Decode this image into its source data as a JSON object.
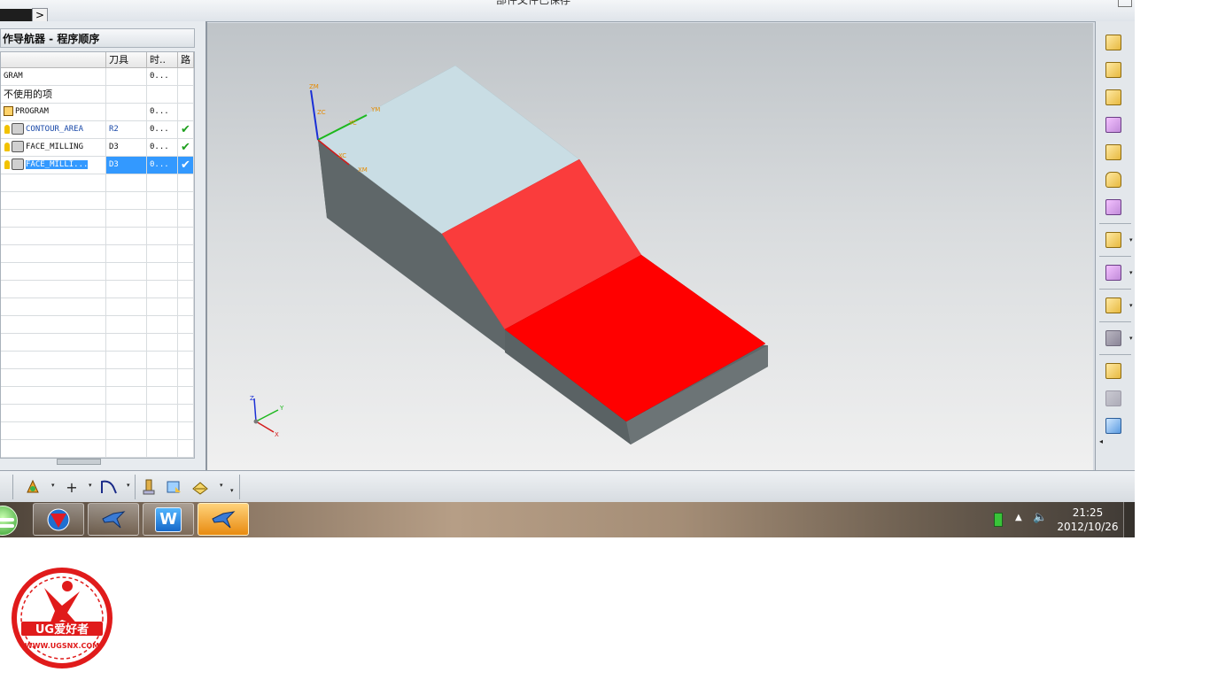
{
  "window": {
    "title": "部件文件已保存",
    "expand_arrow": ">"
  },
  "navigator": {
    "title": "作导航器 - 程序顺序",
    "columns": [
      "",
      "刀具",
      "时..",
      "路"
    ],
    "rows": [
      {
        "name": "GRAM",
        "tool": "",
        "time": "0...",
        "path": "",
        "indent": 0,
        "icon": "none",
        "style": "plain"
      },
      {
        "name": "不使用的项",
        "tool": "",
        "time": "",
        "path": "",
        "indent": 0,
        "icon": "none",
        "style": "plain"
      },
      {
        "name": "PROGRAM",
        "tool": "",
        "time": "0...",
        "path": "",
        "indent": 0,
        "icon": "program-icon",
        "style": "plain"
      },
      {
        "name": "CONTOUR_AREA",
        "tool": "R2",
        "time": "0...",
        "path": "✔",
        "indent": 1,
        "icon": "contour-operation-icon",
        "style": "blue"
      },
      {
        "name": "FACE_MILLING",
        "tool": "D3",
        "time": "0...",
        "path": "✔",
        "indent": 1,
        "icon": "face-milling-operation-icon",
        "style": "plain"
      },
      {
        "name": "FACE_MILLI...",
        "tool": "D3",
        "time": "0...",
        "path": "✔",
        "indent": 1,
        "icon": "face-milling-operation-icon",
        "style": "selected"
      }
    ],
    "empty_rows": 17
  },
  "viewport": {
    "wcs_labels": {
      "zm": "ZM",
      "zc": "ZC",
      "yc": "YC",
      "ym": "YM",
      "xc": "XC",
      "xm": "XM"
    },
    "triad_labels": {
      "z": "Z",
      "y": "Y",
      "x": "X"
    },
    "colors": {
      "top_face": "#c9dde4",
      "mid_face": "#fa3c3c",
      "low_face": "#ff0000",
      "side": "#5f6769"
    }
  },
  "right_toolbar": {
    "tools": [
      "wcs-origin-icon",
      "wcs-rotate-icon",
      "wcs-orient-icon",
      "save-wcs-icon",
      "feature-icon",
      "cylinder-icon",
      "delete-body-icon",
      "copy-geometry-icon",
      "split-geometry-icon",
      "measure-geometry-icon",
      "shaded-body-icon",
      "select-body-icon",
      "dimmed-body-icon",
      "resource-settings-icon"
    ]
  },
  "bottom_toolbar": {
    "tools": [
      "insert-operation-icon",
      "point-icon",
      "curve-icon",
      "tool-holder-icon",
      "blank-icon",
      "fixture-icon"
    ]
  },
  "taskbar": {
    "time": "21:25",
    "date": "2012/10/26",
    "apps": [
      "start-orb",
      "nx-app",
      "bird-app-1",
      "word-app",
      "bird-app-2"
    ]
  },
  "watermark": {
    "line1": "UG爱好者",
    "line2": "WWW.UGSNX.COM"
  }
}
